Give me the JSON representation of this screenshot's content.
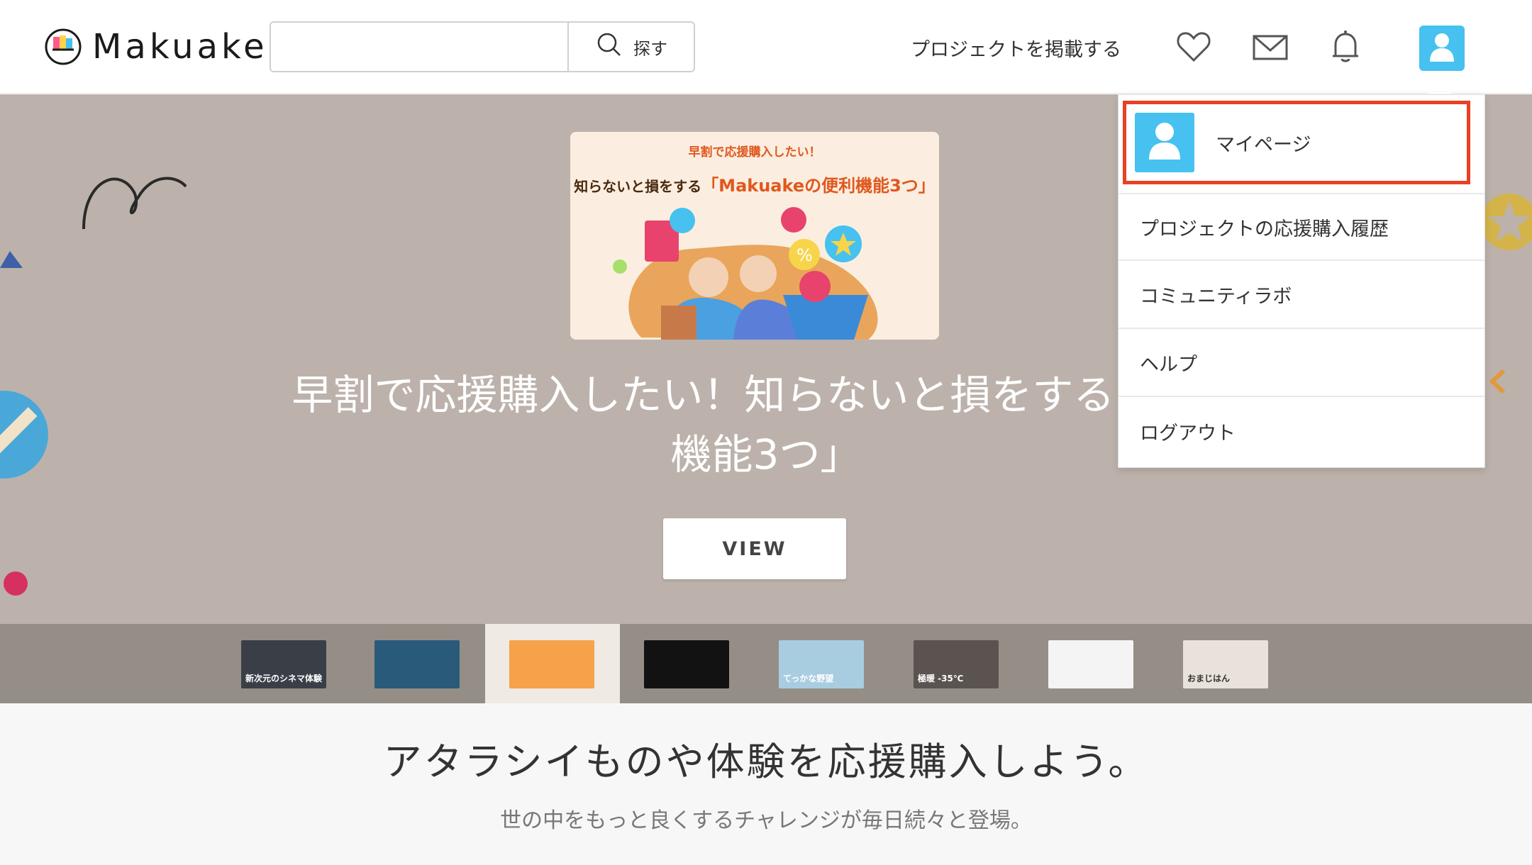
{
  "header": {
    "logo_text": "Makuake",
    "search_placeholder": "",
    "search_button": "探す",
    "post_project": "プロジェクトを掲載する",
    "icons": [
      "heart-icon",
      "mail-icon",
      "bell-icon",
      "user-icon"
    ]
  },
  "hero": {
    "card_subtitle": "早割で応援購入したい！",
    "card_title_prefix": "知らないと損をする",
    "card_title_accent": "「Makuakeの便利機能3つ」",
    "title_line1": "早割で応援購入したい！知らないと損をする「Mak",
    "title_line2": "機能3つ」",
    "view_button": "VIEW"
  },
  "thumbnails": [
    {
      "label": "新次元のシネマ体験",
      "color": "#3a3f47"
    },
    {
      "label": "",
      "color": "#2a5a7a"
    },
    {
      "label": "",
      "color": "#f5a24a"
    },
    {
      "label": "",
      "color": "#121212"
    },
    {
      "label": "てっかな野望",
      "color": "#a9cde0"
    },
    {
      "label": "極暖 -35℃",
      "color": "#5a5350"
    },
    {
      "label": "",
      "color": "#f4f4f4"
    },
    {
      "label": "おまじはん",
      "color": "#e9e2da"
    }
  ],
  "lower": {
    "tagline": "アタラシイものや体験を応援購入しよう。",
    "subline": "世の中をもっと良くするチャレンジが毎日続々と登場。"
  },
  "dropdown": {
    "mypage": "マイページ",
    "items": [
      "プロジェクトの応援購入履歴",
      "コミュニティラボ",
      "ヘルプ",
      "ログアウト"
    ]
  },
  "colors": {
    "accent_blue": "#46c1f0",
    "highlight_red": "#e84124",
    "hero_bg": "#bcb2ab"
  }
}
